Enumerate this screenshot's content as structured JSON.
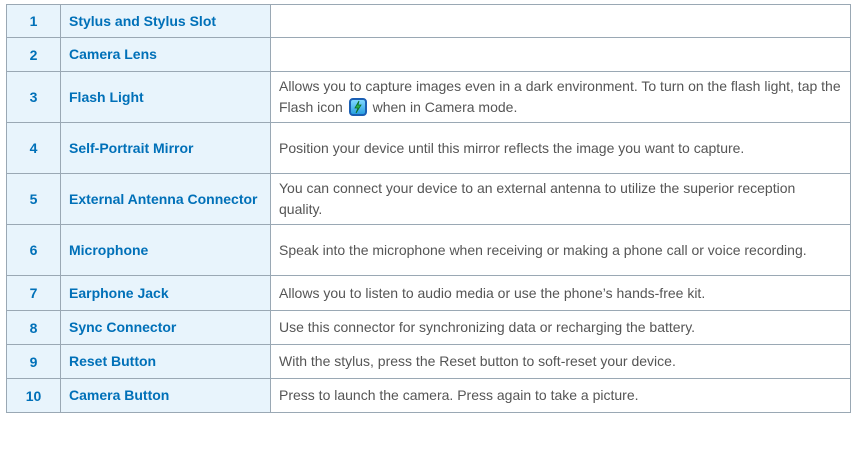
{
  "rows": [
    {
      "num": "1",
      "name": "Stylus and Stylus Slot",
      "desc": ""
    },
    {
      "num": "2",
      "name": "Camera Lens",
      "desc": ""
    },
    {
      "num": "3",
      "name": "Flash Light",
      "desc_before": "Allows you to capture images even in a dark environment. To turn on the flash light, tap the Flash icon",
      "desc_after": "when in Camera mode."
    },
    {
      "num": "4",
      "name": "Self-Portrait Mirror",
      "desc": "Position your device until this mirror reflects the image you want to capture."
    },
    {
      "num": "5",
      "name": "External Antenna Connector",
      "desc": "You can connect your device to an external antenna to utilize the superior reception quality."
    },
    {
      "num": "6",
      "name": "Microphone",
      "desc": "Speak into the microphone when receiving or making a phone call or voice recording."
    },
    {
      "num": "7",
      "name": "Earphone Jack",
      "desc": "Allows you to listen to audio media or use the phone’s hands-free kit."
    },
    {
      "num": "8",
      "name": "Sync Connector",
      "desc": "Use this connector for synchronizing data or recharging the battery."
    },
    {
      "num": "9",
      "name": "Reset Button",
      "desc": "With the stylus, press the Reset button to soft-reset your device."
    },
    {
      "num": "10",
      "name": "Camera Button",
      "desc": "Press to launch the camera. Press again to take a picture."
    }
  ],
  "icons": {
    "flash": "flash-icon"
  },
  "colors": {
    "accent": "#0070b8",
    "header_bg": "#e8f4fc",
    "border": "#9aa8b4",
    "text": "#555555"
  }
}
